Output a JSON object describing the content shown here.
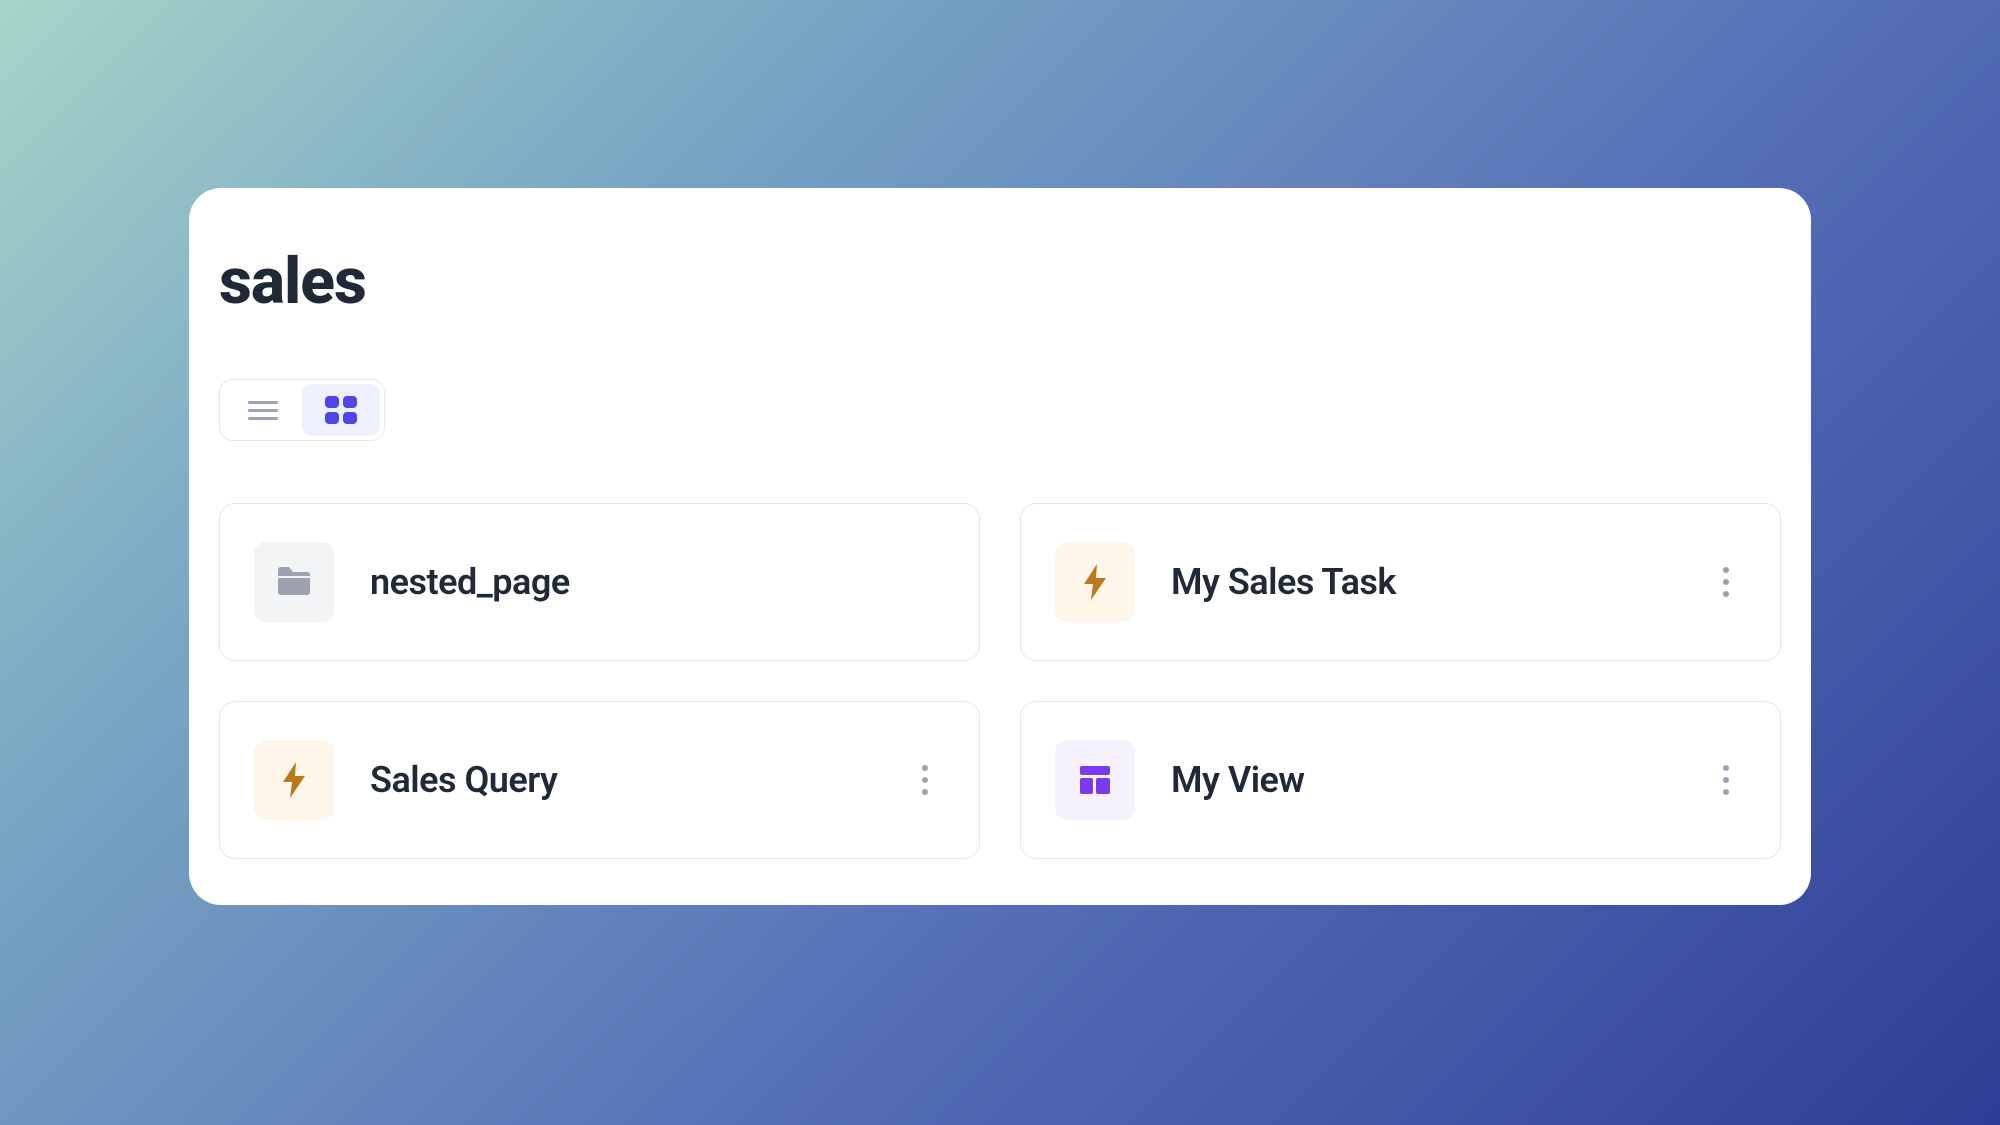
{
  "page": {
    "title": "sales"
  },
  "view_toggle": {
    "active": "grid"
  },
  "cards": [
    {
      "label": "nested_page",
      "icon_type": "folder",
      "has_menu": false
    },
    {
      "label": "My Sales Task",
      "icon_type": "task",
      "has_menu": true
    },
    {
      "label": "Sales Query",
      "icon_type": "task",
      "has_menu": true
    },
    {
      "label": "My View",
      "icon_type": "view",
      "has_menu": true
    }
  ],
  "colors": {
    "accent": "#4f46e5",
    "task_icon": "#b8791f",
    "view_icon": "#7c3aed",
    "folder_icon": "#9ca3af"
  }
}
